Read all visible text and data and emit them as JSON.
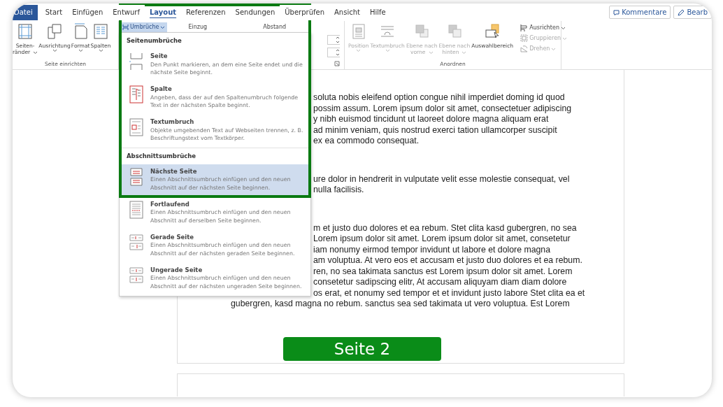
{
  "tabs": [
    {
      "label": "Datei",
      "kind": "file",
      "selected": false
    },
    {
      "label": "Start",
      "kind": "tab",
      "selected": false
    },
    {
      "label": "Einfügen",
      "kind": "tab",
      "selected": false
    },
    {
      "label": "Entwurf",
      "kind": "tab",
      "selected": false
    },
    {
      "label": "Layout",
      "kind": "tab",
      "selected": true
    },
    {
      "label": "Referenzen",
      "kind": "tab",
      "selected": false
    },
    {
      "label": "Sendungen",
      "kind": "tab",
      "selected": false
    },
    {
      "label": "Überprüfen",
      "kind": "tab",
      "selected": false
    },
    {
      "label": "Ansicht",
      "kind": "tab",
      "selected": false
    },
    {
      "label": "Hilfe",
      "kind": "tab",
      "selected": false
    }
  ],
  "header_buttons": [
    {
      "label": "Kommentare",
      "kind": "comment"
    },
    {
      "label": "Bearb",
      "kind": "edit"
    }
  ],
  "ribbon": {
    "page_setup": {
      "buttons": [
        {
          "lines": [
            "Seiten-",
            "ränder"
          ],
          "kind": "margins",
          "dropdown": true
        },
        {
          "lines": [
            "Ausrichtung"
          ],
          "kind": "orientation",
          "dropdown": true
        },
        {
          "lines": [
            "Format"
          ],
          "kind": "size",
          "dropdown": true
        },
        {
          "lines": [
            "Spalten"
          ],
          "kind": "columns",
          "dropdown": true
        }
      ],
      "label": "Seite einrichten"
    },
    "paragraph": {
      "breaks_button": {
        "label": "Umbrüche",
        "open": true
      },
      "indent_label": "Einzug",
      "spacing_label": "Abstand"
    },
    "arrange": {
      "buttons": [
        {
          "lines": [
            "Position"
          ],
          "kind": "position",
          "disabled": true,
          "dropdown": true
        },
        {
          "lines": [
            "Textumbruch"
          ],
          "kind": "wrap",
          "disabled": true,
          "dropdown": true
        },
        {
          "lines": [
            "Ebene nach",
            "vorne"
          ],
          "kind": "forward",
          "disabled": true,
          "dropdown": true
        },
        {
          "lines": [
            "Ebene nach",
            "hinten"
          ],
          "kind": "backward",
          "disabled": true,
          "dropdown": true
        },
        {
          "lines": [
            "Auswahlbereich"
          ],
          "kind": "selection",
          "disabled": false,
          "dropdown": false
        }
      ],
      "small_buttons": [
        {
          "label": "Ausrichten",
          "kind": "align",
          "disabled": false
        },
        {
          "label": "Gruppieren",
          "kind": "group",
          "disabled": true
        },
        {
          "label": "Drehen",
          "kind": "rotate",
          "disabled": true
        }
      ],
      "label": "Anordnen"
    }
  },
  "breaks_menu": {
    "sections": [
      {
        "title": "Seitenumbrüche",
        "items": [
          {
            "title": "Seite",
            "description": "Den Punkt markieren, an dem eine Seite endet und die nächste Seite beginnt.",
            "kind": "page",
            "selected": false
          },
          {
            "title": "Spalte",
            "description": "Angeben, dass der auf den Spaltenumbruch folgende Text in der nächsten Spalte beginnt.",
            "kind": "column",
            "selected": false
          },
          {
            "title": "Textumbruch",
            "description": "Objekte umgebenden Text auf Webseiten trennen, z. B. Beschriftungstext vom Textkörper.",
            "kind": "textwrap",
            "selected": false
          }
        ]
      },
      {
        "title": "Abschnittsumbrüche",
        "items": [
          {
            "title": "Nächste Seite",
            "description": "Einen Abschnittsumbruch einfügen und den neuen Abschnitt auf der nächsten Seite beginnen.",
            "kind": "nextpage",
            "selected": true
          },
          {
            "title": "Fortlaufend",
            "description": "Einen Abschnittsumbruch einfügen und den neuen Abschnitt auf derselben Seite beginnen.",
            "kind": "continuous",
            "selected": false
          },
          {
            "title": "Gerade Seite",
            "description": "Einen Abschnittsumbruch einfügen und den neuen Abschnitt auf der nächsten geraden Seite beginnen.",
            "kind": "even",
            "selected": false
          },
          {
            "title": "Ungerade Seite",
            "description": "Einen Abschnittsumbruch einfügen und den neuen Abschnitt auf der nächsten ungeraden Seite beginnen.",
            "kind": "odd",
            "selected": false
          }
        ]
      }
    ]
  },
  "document": {
    "blocks": [
      {
        "lines": [
          {
            "text": "soluta nobis eleifend option congue nihil imperdiet doming id quod",
            "kind": "partial"
          },
          {
            "text": "possim assum. Lorem ipsum dolor sit amet, consectetuer adipiscing",
            "kind": "partial"
          },
          {
            "text": "y nibh euismod tincidunt ut laoreet dolore magna aliquam erat",
            "kind": "partial"
          },
          {
            "text": "ad minim veniam, quis nostrud exerci tation ullamcorper suscipit",
            "kind": "partial"
          },
          {
            "text": "ex ea commodo consequat.",
            "kind": "partial"
          }
        ]
      },
      {
        "lines": [
          {
            "text": "ure dolor in hendrerit in vulputate velit esse molestie consequat, vel",
            "kind": "partial"
          },
          {
            "text": "nulla facilisis.",
            "kind": "partial"
          }
        ]
      },
      {
        "lines": [
          {
            "text": "m et justo duo dolores et ea rebum. Stet clita kasd gubergren, no sea",
            "kind": "partial"
          },
          {
            "text": "Lorem ipsum dolor sit amet. Lorem ipsum dolor sit amet, consetetur",
            "kind": "partial"
          },
          {
            "text": "iam nonumy eirmod tempor invidunt ut labore et dolore magna",
            "kind": "partial"
          },
          {
            "text": "am voluptua. At vero eos et accusam et justo duo dolores et ea rebum.",
            "kind": "partial"
          },
          {
            "text": "ren, no sea takimata sanctus est Lorem ipsum dolor sit amet. Lorem",
            "kind": "partial"
          },
          {
            "text": "consetetur sadipscing elitr, At accusam aliquyam diam diam dolore",
            "kind": "partial"
          },
          {
            "text": "os erat, et nonumy sed tempor et et invidunt justo labore Stet clita ea et",
            "kind": "partial"
          },
          {
            "text": "gubergren, kasd magna no rebum. sanctus sea sed takimata ut vero voluptua. Est Lorem",
            "kind": "full"
          }
        ]
      }
    ],
    "page_label": "Seite 2"
  }
}
